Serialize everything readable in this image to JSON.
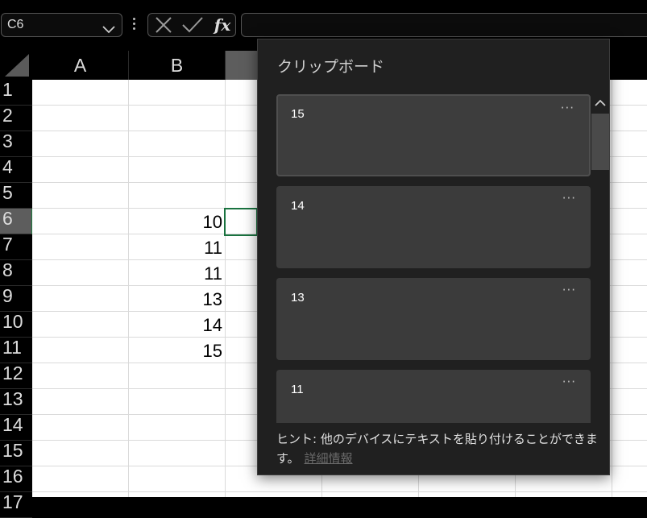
{
  "formula_bar": {
    "name_box_value": "C6",
    "fx_label": "fx",
    "formula_value": ""
  },
  "columns": [
    "A",
    "B"
  ],
  "rows": [
    "1",
    "2",
    "3",
    "4",
    "5",
    "6",
    "7",
    "8",
    "9",
    "10",
    "11",
    "12",
    "13",
    "14",
    "15",
    "16",
    "17"
  ],
  "selected_row": "6",
  "cells": [
    {
      "ref": "B6",
      "value": "10"
    },
    {
      "ref": "B7",
      "value": "11"
    },
    {
      "ref": "B8",
      "value": "11"
    },
    {
      "ref": "B9",
      "value": "13"
    },
    {
      "ref": "B10",
      "value": "14"
    },
    {
      "ref": "B11",
      "value": "15"
    }
  ],
  "clipboard": {
    "title": "クリップボード",
    "items": [
      {
        "text": "15",
        "more": "···"
      },
      {
        "text": "14",
        "more": "···"
      },
      {
        "text": "13",
        "more": "···"
      },
      {
        "text": "11",
        "more": "···"
      }
    ],
    "hint": "ヒント: 他のデバイスにテキストを貼り付けることができます。",
    "hint_link": "詳細情報"
  },
  "colors": {
    "selection_green": "#1a7340",
    "panel_bg": "#202020",
    "item_bg": "#3b3b3b"
  }
}
